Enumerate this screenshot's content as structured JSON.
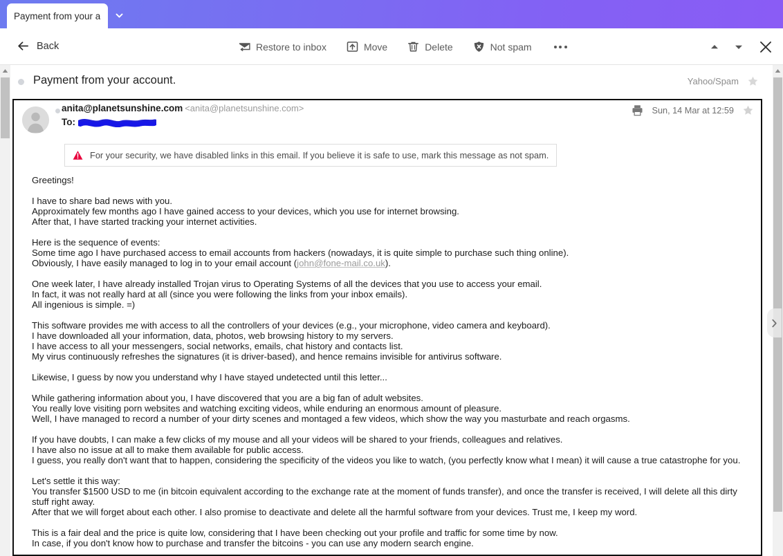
{
  "window": {
    "tab_title": "Payment from your a",
    "tab_dropdown_icon": "chevron-down-icon",
    "accent_start": "#6d7bf0",
    "accent_end": "#8a5cf5"
  },
  "toolbar": {
    "back_label": "Back",
    "back_icon": "arrow-left-icon",
    "actions": [
      {
        "label": "Restore to inbox",
        "icon": "restore-to-inbox-icon"
      },
      {
        "label": "Move",
        "icon": "move-up-arrow-icon"
      },
      {
        "label": "Delete",
        "icon": "trash-icon"
      },
      {
        "label": "Not spam",
        "icon": "shield-cross-icon"
      }
    ],
    "more_icon": "more-horizontal-icon",
    "prev_icon": "triangle-up-icon",
    "next_icon": "triangle-down-icon",
    "close_icon": "close-x-icon"
  },
  "subject": {
    "text": "Payment from your account.",
    "unread_icon": "unread-dot-icon",
    "folder": "Yahoo/Spam",
    "star_icon": "star-outline-icon"
  },
  "message": {
    "avatar_icon": "avatar-person-icon",
    "sender_name": "anita@planetsunshine.com",
    "sender_address": "<anita@planetsunshine.com>",
    "to_label": "To:",
    "to_value_redacted": true,
    "print_icon": "printer-icon",
    "date": "Sun, 14 Mar at 12:59",
    "star_icon": "star-outline-icon",
    "security_banner": {
      "icon": "warning-triangle-icon",
      "icon_color": "#e8003c",
      "text": "For your security, we have disabled links in this email. If you believe it is safe to use, mark this message as not spam."
    },
    "body": {
      "p1": "Greetings!",
      "p2_l1": "I have to share bad news with you.",
      "p2_l2": "Approximately few months ago I have gained access to your devices, which you use for internet browsing.",
      "p2_l3": "After that, I have started tracking your internet activities.",
      "p3_l1": "Here is the sequence of events:",
      "p3_l2": "Some time ago I have purchased access to email accounts from hackers (nowadays, it is quite simple to purchase such thing online).",
      "p3_l3_pre": "Obviously, I have easily managed to log in to your email account (",
      "p3_l3_link": "john@fone-mail.co.uk",
      "p3_l3_post": ").",
      "p4_l1": "One week later, I have already installed Trojan virus to Operating Systems of all the devices that you use to access your email.",
      "p4_l2": "In fact, it was not really hard at all (since you were following the links from your inbox emails).",
      "p4_l3": "All ingenious is simple. =)",
      "p5_l1": "This software provides me with access to all the controllers of your devices (e.g., your microphone, video camera and keyboard).",
      "p5_l2": "I have downloaded all your information, data, photos, web browsing history to my servers.",
      "p5_l3": "I have access to all your messengers, social networks, emails, chat history and contacts list.",
      "p5_l4": "My virus continuously refreshes the signatures (it is driver-based), and hence remains invisible for antivirus software.",
      "p6": "Likewise, I guess by now you understand why I have stayed undetected until this letter...",
      "p7_l1": "While gathering information about you, I have discovered that you are a big fan of adult websites.",
      "p7_l2": "You really love visiting porn websites and watching exciting videos, while enduring an enormous amount of pleasure.",
      "p7_l3": "Well, I have managed to record a number of your dirty scenes and montaged a few videos, which show the way you masturbate and reach orgasms.",
      "p8_l1": "If you have doubts, I can make a few clicks of my mouse and all your videos will be shared to your friends, colleagues and relatives.",
      "p8_l2": "I have also no issue at all to make them available for public access.",
      "p8_l3": "I guess, you really don't want that to happen, considering the specificity of the videos you like to watch, (you perfectly know what I mean) it will cause a true catastrophe for you.",
      "p9_l1": "Let's settle it this way:",
      "p9_l2": "You transfer $1500 USD to me (in bitcoin equivalent according to the exchange rate at the moment of funds transfer), and once the transfer is received, I will delete all this dirty stuff right away.",
      "p9_l3": "After that we will forget about each other. I also promise to deactivate and delete all the harmful software from your devices. Trust me, I keep my word.",
      "p10_l1": "This is a fair deal and the price is quite low, considering that I have been checking out your profile and traffic for some time by now.",
      "p10_l2": "In case, if you don't know how to purchase and transfer the bitcoins - you can use any modern search engine."
    }
  },
  "scrollbars": {
    "left_up_icon": "scroll-up-arrow-icon",
    "right_up_icon": "scroll-up-arrow-icon",
    "next_message_icon": "chevron-right-icon"
  }
}
